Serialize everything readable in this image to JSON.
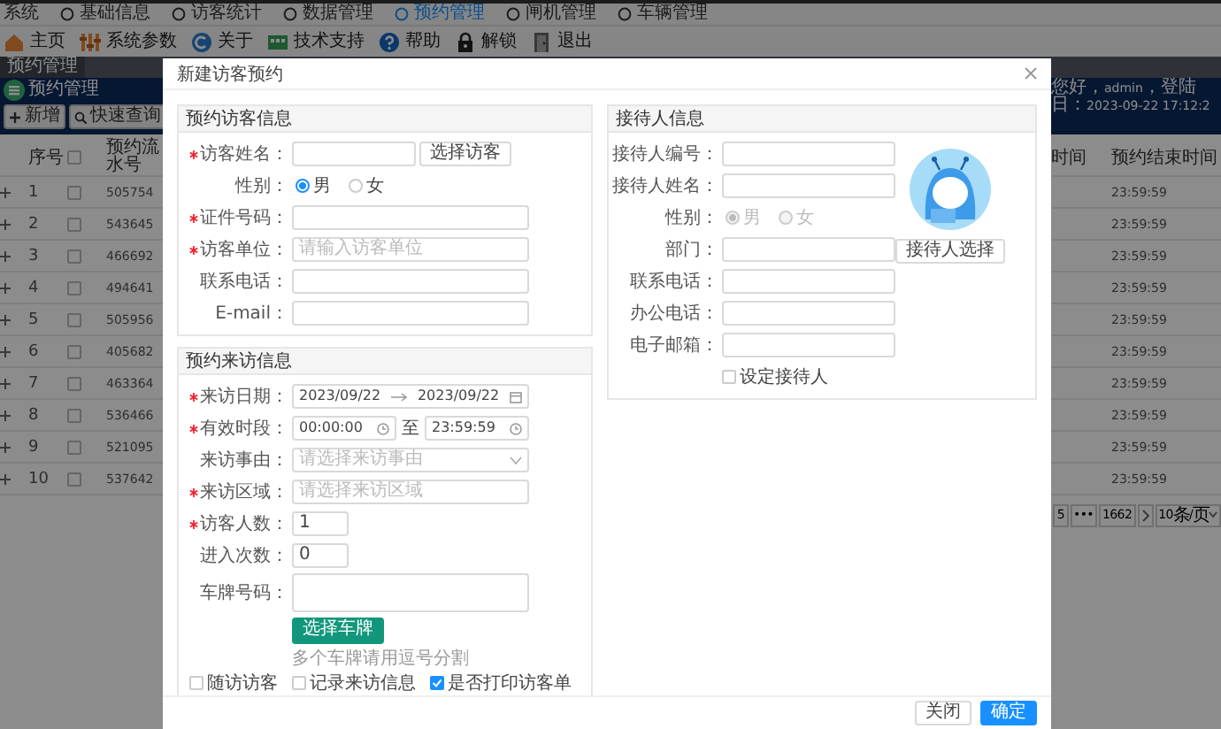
{
  "menu": [
    {
      "label": "系统",
      "selected": false
    },
    {
      "label": "基础信息",
      "selected": false
    },
    {
      "label": "访客统计",
      "selected": false
    },
    {
      "label": "数据管理",
      "selected": false
    },
    {
      "label": "预约管理",
      "selected": true
    },
    {
      "label": "闸机管理",
      "selected": false
    },
    {
      "label": "车辆管理",
      "selected": false
    }
  ],
  "toolbar": [
    {
      "label": "主页",
      "kind": "home"
    },
    {
      "label": "系统参数",
      "kind": "settings"
    },
    {
      "label": "关于",
      "kind": "about"
    },
    {
      "label": "技术支持",
      "kind": "support"
    },
    {
      "label": "帮助",
      "kind": "help"
    },
    {
      "label": "解锁",
      "kind": "unlock"
    },
    {
      "label": "退出",
      "kind": "exit"
    }
  ],
  "page_tab": "预约管理",
  "header": {
    "title": "预约管理",
    "buttons": [
      {
        "label": "新增",
        "kind": "add"
      },
      {
        "label": "快速查询",
        "kind": "search"
      }
    ],
    "greeting": "您好，admin，登陆日：2023-09-22 17:12:2"
  },
  "table": {
    "index_header": "序号",
    "id_header": "预约流水号",
    "column_5_header": "时间",
    "column_6_header": "预约结束时间",
    "all_checked": false,
    "rows": [
      {
        "index": "1",
        "id": "505754",
        "checked": false,
        "column_6": "23:59:59"
      },
      {
        "index": "2",
        "id": "543645",
        "checked": false,
        "column_6": "23:59:59"
      },
      {
        "index": "3",
        "id": "466692",
        "checked": false,
        "column_6": "23:59:59"
      },
      {
        "index": "4",
        "id": "494641",
        "checked": false,
        "column_6": "23:59:59"
      },
      {
        "index": "5",
        "id": "505956",
        "checked": false,
        "column_6": "23:59:59"
      },
      {
        "index": "6",
        "id": "405682",
        "checked": false,
        "column_6": "23:59:59"
      },
      {
        "index": "7",
        "id": "463364",
        "checked": false,
        "column_6": "23:59:59"
      },
      {
        "index": "8",
        "id": "536466",
        "checked": false,
        "column_6": "23:59:59"
      },
      {
        "index": "9",
        "id": "521095",
        "checked": false,
        "column_6": "23:59:59"
      },
      {
        "index": "10",
        "id": "537642",
        "checked": false,
        "column_6": "23:59:59"
      }
    ]
  },
  "pagination": {
    "pages": [
      "5",
      "•••",
      "1662"
    ],
    "page_size": "10条/页"
  },
  "modal": {
    "title": "新建访客预约",
    "visitor": {
      "title": "预约访客信息",
      "fields": [
        {
          "kind": "input",
          "label": "访客姓名：",
          "required": true,
          "button": "选择访客"
        },
        {
          "kind": "radio",
          "label": "性别：",
          "required": false,
          "disabled": false,
          "options": [
            {
              "label": "男",
              "selected": true
            },
            {
              "label": "女",
              "selected": false
            }
          ]
        },
        {
          "kind": "input",
          "label": "证件号码：",
          "required": true
        },
        {
          "kind": "input",
          "label": "访客单位：",
          "required": true,
          "placeholder": "请输入访客单位"
        },
        {
          "kind": "input",
          "label": "联系电话：",
          "required": false
        },
        {
          "kind": "input",
          "label": "E-mail：",
          "required": false
        }
      ]
    },
    "visit": {
      "title": "预约来访信息",
      "fields": [
        {
          "kind": "daterange",
          "label": "来访日期：",
          "required": true,
          "start": "2023/09/22",
          "end": "2023/09/22"
        },
        {
          "kind": "timerange",
          "label": "有效时段：",
          "required": true,
          "start": "00:00:00",
          "separator": "至",
          "end": "23:59:59"
        },
        {
          "kind": "select",
          "label": "来访事由：",
          "required": false,
          "placeholder": "请选择来访事由"
        },
        {
          "kind": "input",
          "label": "来访区域：",
          "required": true,
          "placeholder": "请选择来访区域"
        },
        {
          "kind": "number",
          "label": "访客人数：",
          "required": true,
          "value": "1"
        },
        {
          "kind": "number",
          "label": "进入次数：",
          "required": false,
          "value": "0"
        },
        {
          "kind": "textarea",
          "label": "车牌号码：",
          "required": false
        },
        {
          "kind": "action",
          "label": "选择车牌"
        },
        {
          "kind": "hint",
          "text": "多个车牌请用逗号分割"
        },
        {
          "kind": "checks",
          "options": [
            {
              "label": "随访访客",
              "checked": false
            },
            {
              "label": "记录来访信息",
              "checked": false
            },
            {
              "label": "是否打印访客单",
              "checked": true
            }
          ]
        }
      ]
    },
    "host": {
      "title": "接待人信息",
      "avatar_button": "接待人选择",
      "fields": [
        {
          "kind": "input",
          "label": "接待人编号：",
          "required": false
        },
        {
          "kind": "input",
          "label": "接待人姓名：",
          "required": false
        },
        {
          "kind": "radio",
          "label": "性别：",
          "required": false,
          "disabled": true,
          "options": [
            {
              "label": "男",
              "selected": true
            },
            {
              "label": "女",
              "selected": false
            }
          ]
        },
        {
          "kind": "input",
          "label": "部门：",
          "required": false
        },
        {
          "kind": "input",
          "label": "联系电话：",
          "required": false
        },
        {
          "kind": "input",
          "label": "办公电话：",
          "required": false
        },
        {
          "kind": "input",
          "label": "电子邮箱：",
          "required": false
        },
        {
          "kind": "checkbox",
          "label": "设定接待人",
          "checked": false
        }
      ]
    },
    "footer": [
      {
        "label": "关闭",
        "kind": "default"
      },
      {
        "label": "确定",
        "kind": "primary"
      }
    ]
  }
}
